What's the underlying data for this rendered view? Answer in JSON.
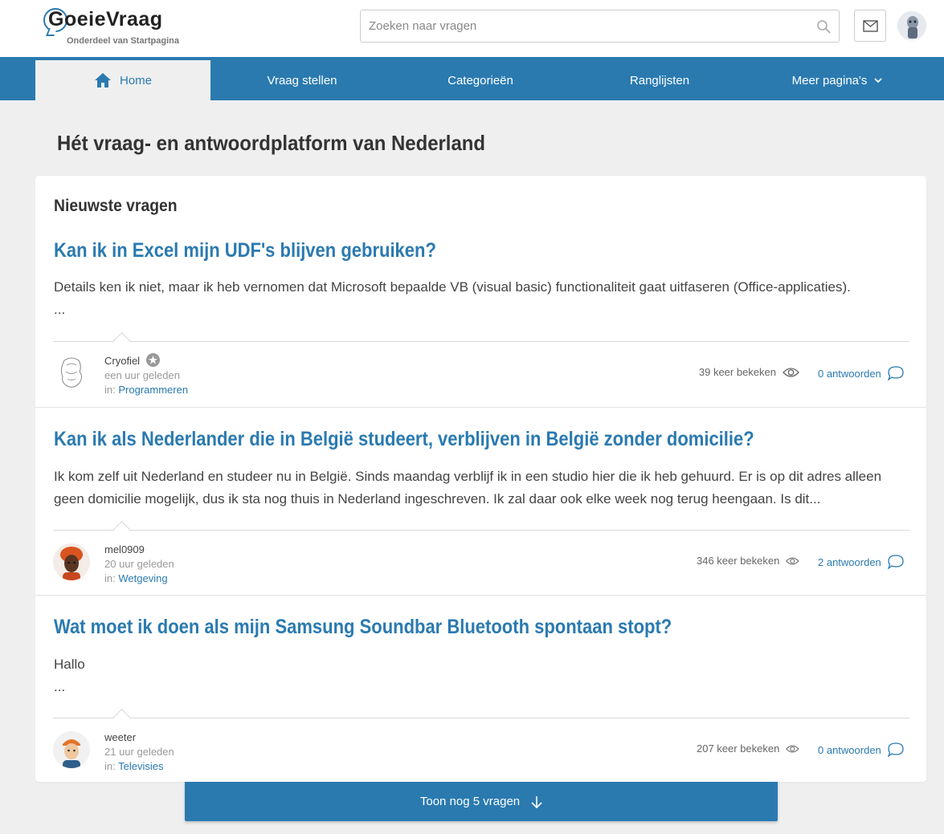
{
  "header": {
    "logo_text": "GoeieVraag",
    "logo_sub": "Onderdeel van Startpagina",
    "search_placeholder": "Zoeken naar vragen"
  },
  "nav": {
    "items": [
      {
        "label": "Home",
        "icon": "home-icon",
        "active": true
      },
      {
        "label": "Vraag stellen"
      },
      {
        "label": "Categorieën"
      },
      {
        "label": "Ranglijsten"
      },
      {
        "label": "Meer pagina's",
        "icon": "chevron-down-icon"
      }
    ]
  },
  "page": {
    "title": "Hét vraag- en antwoordplatform van Nederland",
    "section_title": "Nieuwste vragen"
  },
  "questions": [
    {
      "title": "Kan ik in Excel mijn UDF's blijven gebruiken?",
      "body": "Details ken ik niet, maar ik heb vernomen dat Microsoft bepaalde VB (visual basic) functionaliteit gaat uitfaseren (Office-applicaties).",
      "body_more": "...",
      "user": "Cryofiel",
      "time": "een uur geleden",
      "in_label": "in:",
      "category": "Programmeren",
      "views": "39 keer bekeken",
      "answers": "0 antwoorden"
    },
    {
      "title": "Kan ik als Nederlander die in België studeert, verblijven in België zonder domicilie?",
      "body": "Ik kom zelf uit Nederland en studeer nu in België. Sinds maandag verblijf ik in een studio hier die ik heb gehuurd. Er is op dit adres alleen geen domicilie mogelijk, dus ik sta nog thuis in Nederland ingeschreven. Ik zal daar ook elke week nog terug heengaan. Is dit...",
      "user": "mel0909",
      "time": "20 uur geleden",
      "in_label": "in:",
      "category": "Wetgeving",
      "views": "346 keer bekeken",
      "answers": "2 antwoorden"
    },
    {
      "title": "Wat moet ik doen als mijn Samsung Soundbar Bluetooth spontaan stopt?",
      "body": "Hallo",
      "body_more": "...",
      "user": "weeter",
      "time": "21 uur geleden",
      "in_label": "in:",
      "category": "Televisies",
      "views": "207 keer bekeken",
      "answers": "0 antwoorden"
    }
  ],
  "more_button": "Toon nog 5 vragen",
  "colors": {
    "brand": "#2a7ab0",
    "background": "#efefef"
  }
}
